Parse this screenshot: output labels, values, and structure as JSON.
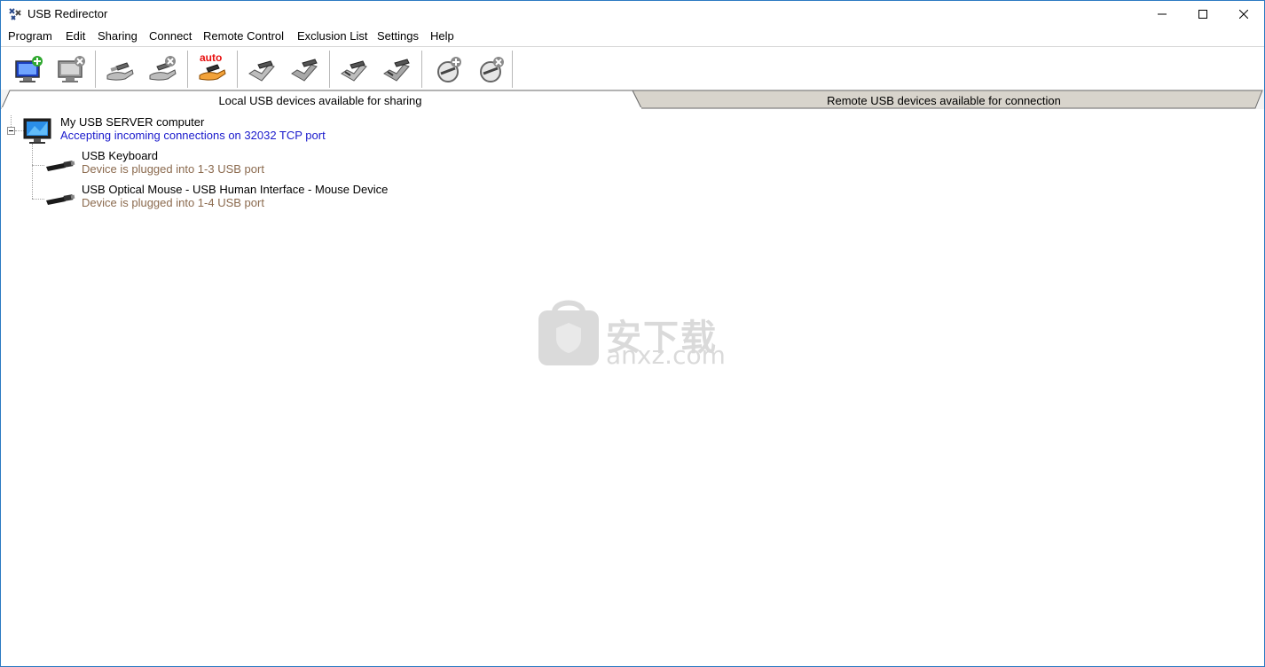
{
  "window": {
    "title": "USB Redirector"
  },
  "menu": [
    "Program",
    "Edit",
    "Sharing",
    "Connect",
    "Remote Control",
    "Exclusion List",
    "Settings",
    "Help"
  ],
  "toolbar": {
    "buttons": [
      {
        "name": "add-server-icon"
      },
      {
        "name": "remove-server-icon"
      },
      {
        "name": "share-device-icon"
      },
      {
        "name": "unshare-device-icon"
      },
      {
        "name": "auto-share-icon",
        "label": "auto"
      },
      {
        "name": "connect-device-icon"
      },
      {
        "name": "disconnect-device-icon"
      },
      {
        "name": "connect-all-icon"
      },
      {
        "name": "disconnect-all-icon"
      },
      {
        "name": "add-exclusion-icon"
      },
      {
        "name": "remove-exclusion-icon"
      }
    ]
  },
  "tabs": {
    "local": "Local USB devices available for sharing",
    "remote": "Remote USB devices available for connection"
  },
  "tree": {
    "server": {
      "name": "My USB SERVER computer",
      "status": "Accepting incoming connections on 32032 TCP port"
    },
    "devices": [
      {
        "name": "USB Keyboard",
        "status": "Device is plugged into 1-3 USB port"
      },
      {
        "name": "USB Optical Mouse - USB Human Interface - Mouse Device",
        "status": "Device is plugged into 1-4 USB port"
      }
    ]
  },
  "watermark": {
    "cn": "安下载",
    "en": "anxz.com"
  },
  "colors": {
    "server_status": "#1a1acc",
    "device_status": "#8b6a4e",
    "window_border": "#2b79c2"
  }
}
